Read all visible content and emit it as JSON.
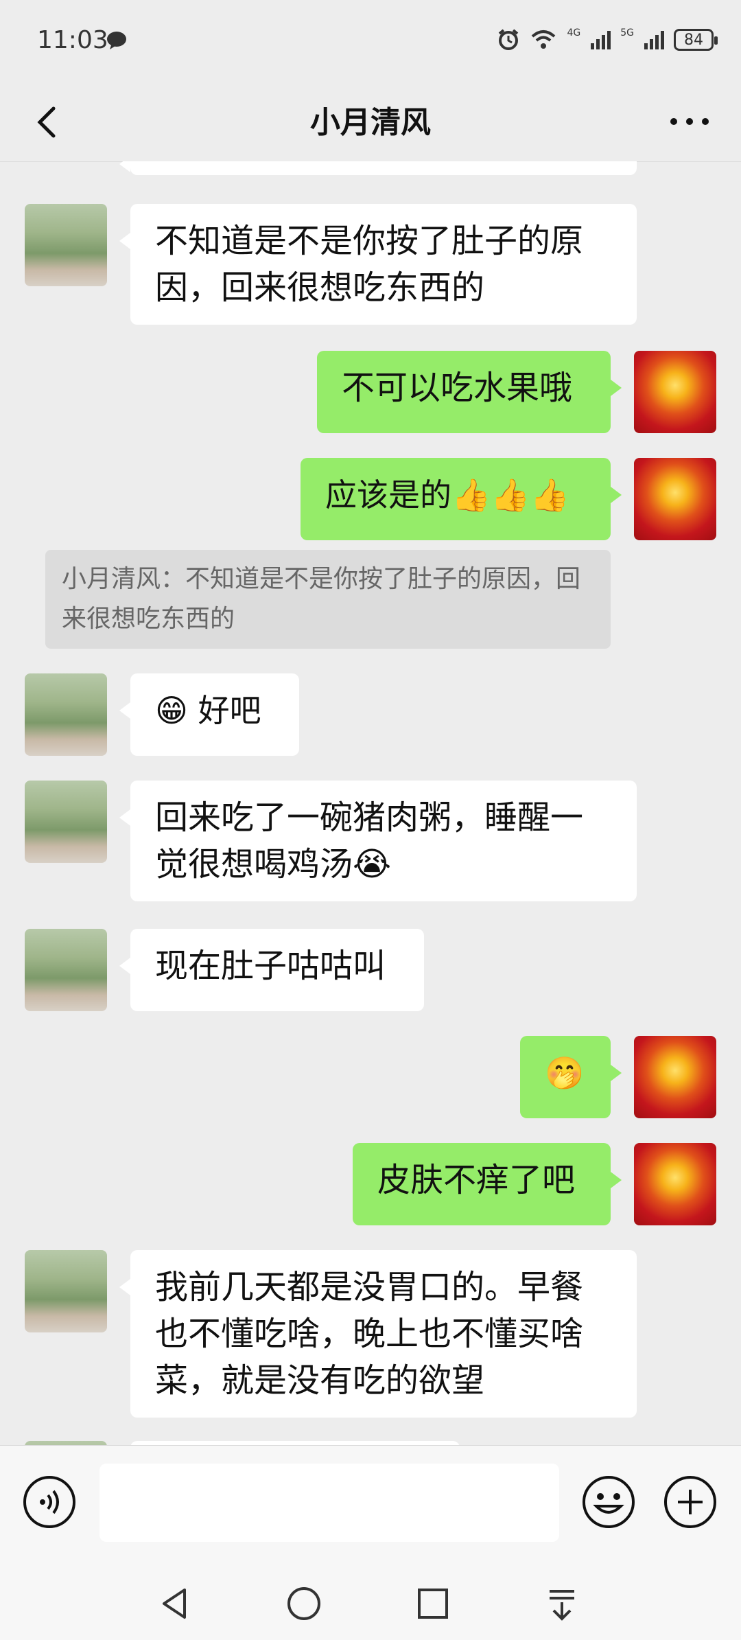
{
  "status_bar": {
    "time": "11:03",
    "network_1": "4G",
    "network_2": "5G",
    "battery": "84"
  },
  "header": {
    "title": "小月清风",
    "back_icon": "chevron-left-icon",
    "more_icon": "more-dots-icon"
  },
  "messages": [
    {
      "side": "in",
      "text": "不知道是不是你按了肚子的原因，回来很想吃东西的"
    },
    {
      "side": "out",
      "text": "不可以吃水果哦"
    },
    {
      "side": "out",
      "text": "应该是的👍👍👍"
    },
    {
      "side": "quote",
      "text": "小月清风：不知道是不是你按了肚子的原因，回来很想吃东西的"
    },
    {
      "side": "in",
      "text": "😁 好吧"
    },
    {
      "side": "in",
      "text": "回来吃了一碗猪肉粥，睡醒一觉很想喝鸡汤😭"
    },
    {
      "side": "in",
      "text": "现在肚子咕咕叫"
    },
    {
      "side": "out",
      "text": "🤭"
    },
    {
      "side": "out",
      "text": "皮肤不痒了吧"
    },
    {
      "side": "in",
      "text": "我前几天都是没胃口的。早餐也不懂吃啥，晚上也不懂买啥菜，就是没有吃的欲望"
    }
  ],
  "input_bar": {
    "voice_icon": "voice-icon",
    "emoji_icon": "emoji-icon",
    "plus_icon": "plus-icon",
    "value": ""
  },
  "navigation": {
    "back": "nav-back-icon",
    "home": "nav-home-icon",
    "recents": "nav-recents-icon",
    "notifications": "nav-pulldown-icon"
  },
  "colors": {
    "background": "#ededed",
    "out_bubble": "#95ec69",
    "in_bubble": "#ffffff"
  }
}
